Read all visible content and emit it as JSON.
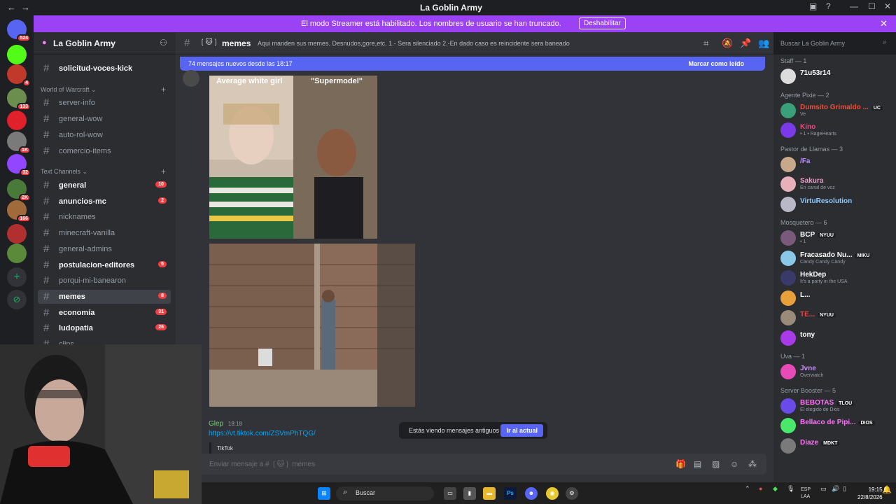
{
  "window": {
    "title": "La Goblin Army"
  },
  "streamer_banner": {
    "message": "El modo Streamer está habilitado. Los nombres de usuario se han truncado.",
    "button_label": "Deshabilitar"
  },
  "servers": [
    {
      "icon": "discord-home-icon",
      "color": "#5865f2",
      "badge": "524"
    },
    {
      "icon": "server-kick-icon",
      "color": "#53fc18",
      "badge": ""
    },
    {
      "icon": "server-red-icon",
      "color": "#c0392b",
      "badge": "4"
    },
    {
      "icon": "server-green-icon",
      "color": "#6b8e4e",
      "badge": "133"
    },
    {
      "icon": "server-red-white-icon",
      "color": "#e0202a",
      "badge": ""
    },
    {
      "icon": "server-grey-icon",
      "color": "#7a7a7a",
      "badge": "1K"
    },
    {
      "icon": "server-twitch-icon",
      "color": "#9146ff",
      "badge": "32"
    },
    {
      "icon": "server-goblin-icon",
      "color": "#4a7a3a",
      "badge": "2K"
    },
    {
      "icon": "server-face-icon",
      "color": "#a06a3a",
      "badge": "166"
    },
    {
      "icon": "server-red2-icon",
      "color": "#b03030",
      "badge": ""
    },
    {
      "icon": "server-goblin2-icon",
      "color": "#5a8a3a",
      "badge": ""
    }
  ],
  "guild": {
    "name": "La Goblin Army"
  },
  "channels_top": [
    {
      "label": "solicitud-voces-kick",
      "unread": true
    }
  ],
  "categories": {
    "wow": "World of Warcraft",
    "text": "Text Channels"
  },
  "wow_channels": [
    {
      "label": "server-info"
    },
    {
      "label": "general-wow"
    },
    {
      "label": "auto-rol-wow"
    },
    {
      "label": "comercio-items"
    }
  ],
  "text_channels": [
    {
      "label": "general",
      "count": "10"
    },
    {
      "label": "anuncios-mc",
      "count": "2"
    },
    {
      "label": "nicknames",
      "count": ""
    },
    {
      "label": "minecraft-vanilla",
      "count": ""
    },
    {
      "label": "general-admins",
      "count": ""
    },
    {
      "label": "postulacion-editores",
      "count": "5"
    },
    {
      "label": "porqui-mi-banearon",
      "count": ""
    },
    {
      "label": "memes",
      "count": "8",
      "active": true
    },
    {
      "label": "economía",
      "count": "31"
    },
    {
      "label": "ludopatia",
      "count": "26"
    },
    {
      "label": "clips",
      "count": ""
    }
  ],
  "header": {
    "channel_name": "memes",
    "topic": "Aqui manden sus memes. Desnudos,gore,etc. 1.- Sera silenciado 2.-En dado caso es reincidente sera baneado",
    "search_placeholder": "Buscar La Goblin Army"
  },
  "new_messages": {
    "text": "74 mensajes nuevos desde las 18:17",
    "mark_read": "Marcar como leído"
  },
  "meme": {
    "left_caption": "Average white girl",
    "right_caption": "\"Supermodel\""
  },
  "message": {
    "author": "Glep",
    "time": "18:18",
    "link": "https://vt.tiktok.com/ZSVmPhTQG/",
    "embed_provider": "TikTok"
  },
  "old_messages": {
    "text": "Estás viendo mensajes antiguos",
    "button": "Ir al actual"
  },
  "composer": {
    "placeholder": "Enviar mensaje a # ❲🐱❳ memes"
  },
  "member_groups": [
    {
      "role": "Staff — 1",
      "members": [
        {
          "name": "71u53r14",
          "color": "#ffffff",
          "status": "",
          "av": "#dcdcdc"
        }
      ]
    },
    {
      "role": "Agente Pixie — 2",
      "members": [
        {
          "name": "Dumsito Grimaldo ...",
          "color": "#e8503a",
          "tag": "UC",
          "status": "Ve",
          "av": "#3aa07a"
        },
        {
          "name": "Kino",
          "color": "#e84a7a",
          "status": "• 1 • RageHearts",
          "av": "#7a3ae8"
        }
      ]
    },
    {
      "role": "Pastor de Llamas — 3",
      "members": [
        {
          "name": "/Fa",
          "color": "#b88cff",
          "status": "",
          "av": "#c8a88a"
        },
        {
          "name": "Sakura",
          "color": "#e8a0c8",
          "status": "En canal de voz",
          "av": "#e8b0b8"
        },
        {
          "name": "VirtuResolution",
          "color": "#8cc8ff",
          "status": "",
          "av": "#b8b8c8"
        }
      ]
    },
    {
      "role": "Mosquetero — 6",
      "members": [
        {
          "name": "BCP",
          "color": "#ffffff",
          "tag": "NYUU",
          "status": "• 1",
          "av": "#7a5a7a"
        },
        {
          "name": "Fracasado Nu...",
          "color": "#ffffff",
          "tag": "MIKU",
          "status": "Candy Candy Candy",
          "av": "#8ac8e8"
        },
        {
          "name": "HekDep",
          "color": "#ffffff",
          "status": "It's a party in the USA",
          "av": "#3a3a6a"
        },
        {
          "name": "L...",
          "color": "#ffffff",
          "status": "",
          "av": "#e8a03a"
        },
        {
          "name": "TE...",
          "color": "#e84a4a",
          "tag": "NYUU",
          "status": "",
          "av": "#9a8a7a"
        },
        {
          "name": "tony",
          "color": "#ffffff",
          "status": "",
          "av": "#a83ae8"
        }
      ]
    },
    {
      "role": "Uva — 1",
      "members": [
        {
          "name": "Jvne",
          "color": "#c88cff",
          "status": "Overwatch",
          "av": "#e84ab8"
        }
      ]
    },
    {
      "role": "Server Booster — 5",
      "members": [
        {
          "name": "BEBOTAS",
          "color": "#ff73fa",
          "tag": "TLOU",
          "status": "El elegido de Dios",
          "av": "#6a4ae8"
        },
        {
          "name": "Bellaco de Pipi...",
          "color": "#ff73fa",
          "tag": "DIOS",
          "status": "",
          "av": "#4ae86a"
        },
        {
          "name": "Diaze",
          "color": "#ff73fa",
          "tag": "MDKT",
          "status": "",
          "av": "#7a7a7a"
        }
      ]
    }
  ],
  "taskbar": {
    "search": "Buscar",
    "lang": "ESP",
    "lang2": "LAA",
    "time": "19:15",
    "date": "22/8/2026"
  }
}
